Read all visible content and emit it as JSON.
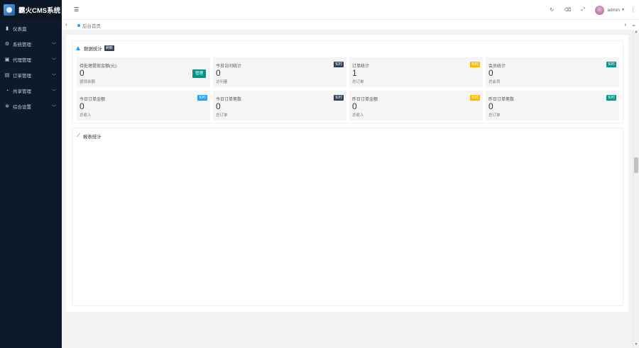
{
  "brand": {
    "title": "霸火CMS系统"
  },
  "sidebar": {
    "items": [
      {
        "label": "仪表盘",
        "icon": "dashboard-icon",
        "has_children": false
      },
      {
        "label": "系统管理",
        "icon": "gear-icon",
        "has_children": true
      },
      {
        "label": "代理管理",
        "icon": "agent-icon",
        "has_children": true
      },
      {
        "label": "订单管理",
        "icon": "order-icon",
        "has_children": true
      },
      {
        "label": "共享管理",
        "icon": "share-icon",
        "has_children": true
      },
      {
        "label": "综合设置",
        "icon": "settings-icon",
        "has_children": true
      }
    ]
  },
  "header": {
    "user_name": "admin",
    "tools": [
      "refresh-icon",
      "clear-icon",
      "fullscreen-icon"
    ]
  },
  "tabs": {
    "items": [
      {
        "label": "后台首页",
        "active": true
      }
    ]
  },
  "stats": {
    "title": "数据统计",
    "title_badge": "刷新",
    "cards": [
      {
        "title": "待处理提现金额(元)",
        "value": "0",
        "sub": "提现余额",
        "button": "管理"
      },
      {
        "title": "今日访问统计",
        "value": "0",
        "sub": "访问量",
        "badge": "实时",
        "badge_color": "#2f4056"
      },
      {
        "title": "订单统计",
        "value": "1",
        "sub": "总订单",
        "badge": "实时",
        "badge_color": "#ffb800"
      },
      {
        "title": "会员统计",
        "value": "0",
        "sub": "总会员",
        "badge": "实时",
        "badge_color": "#009688"
      },
      {
        "title": "今日订单金额",
        "value": "0",
        "sub": "总收入",
        "badge": "实时",
        "badge_color": "#1e9fff"
      },
      {
        "title": "今日订单笔数",
        "value": "0",
        "sub": "总订单",
        "badge": "实时",
        "badge_color": "#2f4056"
      },
      {
        "title": "昨日订单金额",
        "value": "0",
        "sub": "总收入",
        "badge": "实时",
        "badge_color": "#ffb800"
      },
      {
        "title": "昨日订单笔数",
        "value": "0",
        "sub": "总订单",
        "badge": "实时",
        "badge_color": "#009688"
      }
    ]
  },
  "chart": {
    "title": "报表统计"
  }
}
